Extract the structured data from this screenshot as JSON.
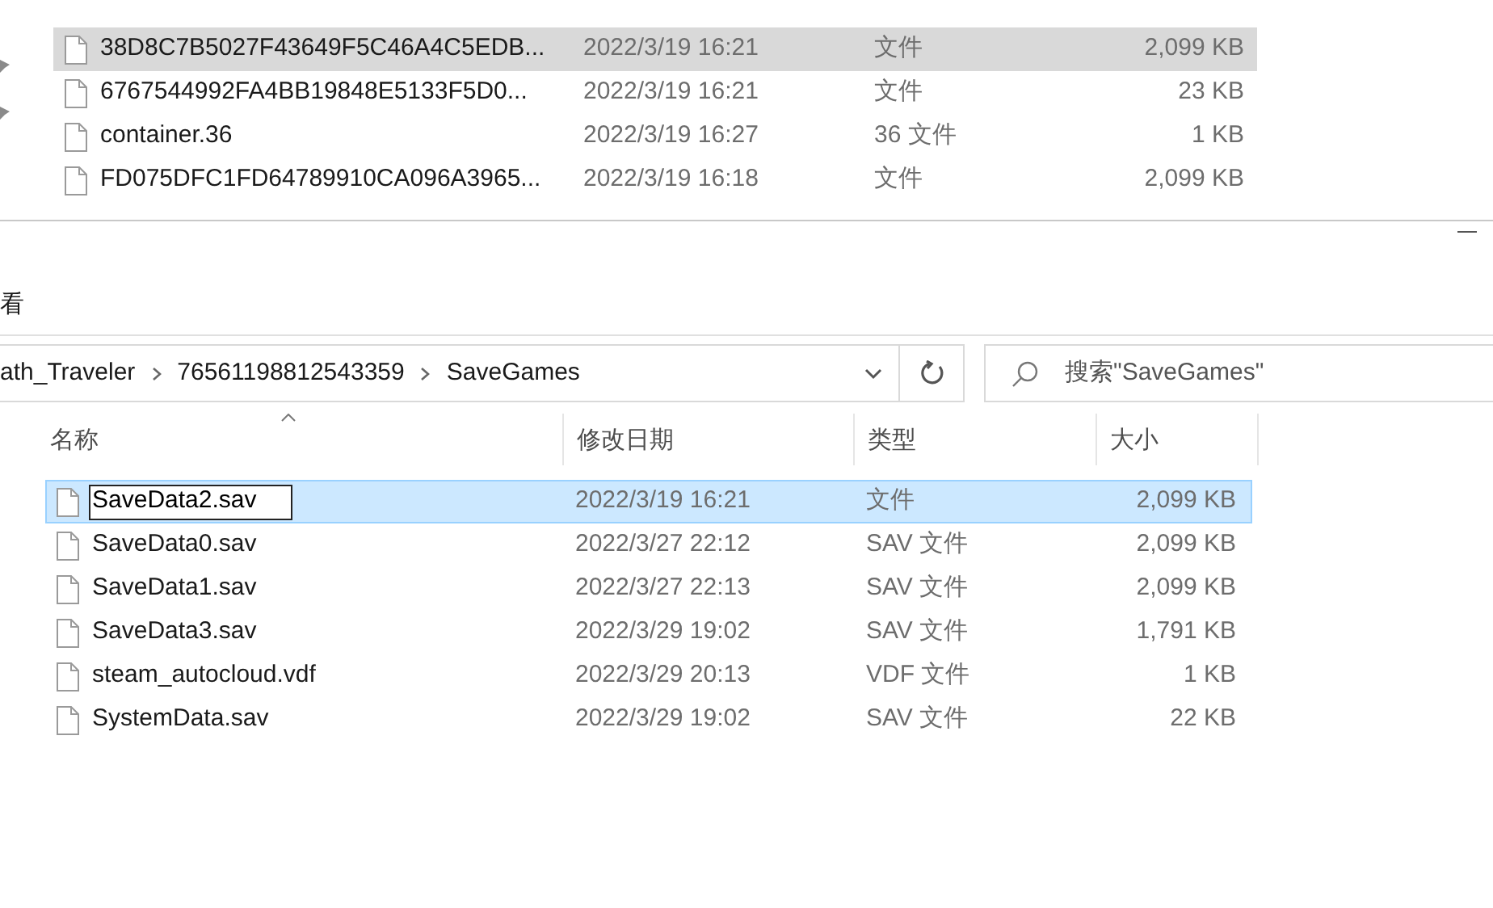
{
  "back_window": {
    "rows": [
      {
        "name": "38D8C7B5027F43649F5C46A4C5EDB...",
        "date": "2022/3/19 16:21",
        "type": "文件",
        "size": "2,099 KB",
        "selected": true
      },
      {
        "name": "6767544992FA4BB19848E5133F5D0...",
        "date": "2022/3/19 16:21",
        "type": "文件",
        "size": "23 KB",
        "selected": false
      },
      {
        "name": "container.36",
        "date": "2022/3/19 16:27",
        "type": "36 文件",
        "size": "1 KB",
        "selected": false
      },
      {
        "name": "FD075DFC1FD64789910CA096A3965...",
        "date": "2022/3/19 16:18",
        "type": "文件",
        "size": "2,099 KB",
        "selected": false
      }
    ]
  },
  "window": {
    "menu": [
      "看"
    ],
    "breadcrumb": [
      "ath_Traveler",
      "76561198812543359",
      "SaveGames"
    ],
    "search": {
      "placeholder": "搜索\"SaveGames\""
    },
    "columns": [
      {
        "label": "名称",
        "sorted": true
      },
      {
        "label": "修改日期",
        "sorted": false
      },
      {
        "label": "类型",
        "sorted": false
      },
      {
        "label": "大小",
        "sorted": false
      }
    ],
    "rows": [
      {
        "name": "SaveData2.sav",
        "date": "2022/3/19 16:21",
        "type": "文件",
        "size": "2,099 KB",
        "selected": true,
        "renaming": true
      },
      {
        "name": "SaveData0.sav",
        "date": "2022/3/27 22:12",
        "type": "SAV 文件",
        "size": "2,099 KB",
        "selected": false,
        "renaming": false
      },
      {
        "name": "SaveData1.sav",
        "date": "2022/3/27 22:13",
        "type": "SAV 文件",
        "size": "2,099 KB",
        "selected": false,
        "renaming": false
      },
      {
        "name": "SaveData3.sav",
        "date": "2022/3/29 19:02",
        "type": "SAV 文件",
        "size": "1,791 KB",
        "selected": false,
        "renaming": false
      },
      {
        "name": "steam_autocloud.vdf",
        "date": "2022/3/29 20:13",
        "type": "VDF 文件",
        "size": "1 KB",
        "selected": false,
        "renaming": false
      },
      {
        "name": "SystemData.sav",
        "date": "2022/3/29 19:02",
        "type": "SAV 文件",
        "size": "22 KB",
        "selected": false,
        "renaming": false
      }
    ]
  }
}
